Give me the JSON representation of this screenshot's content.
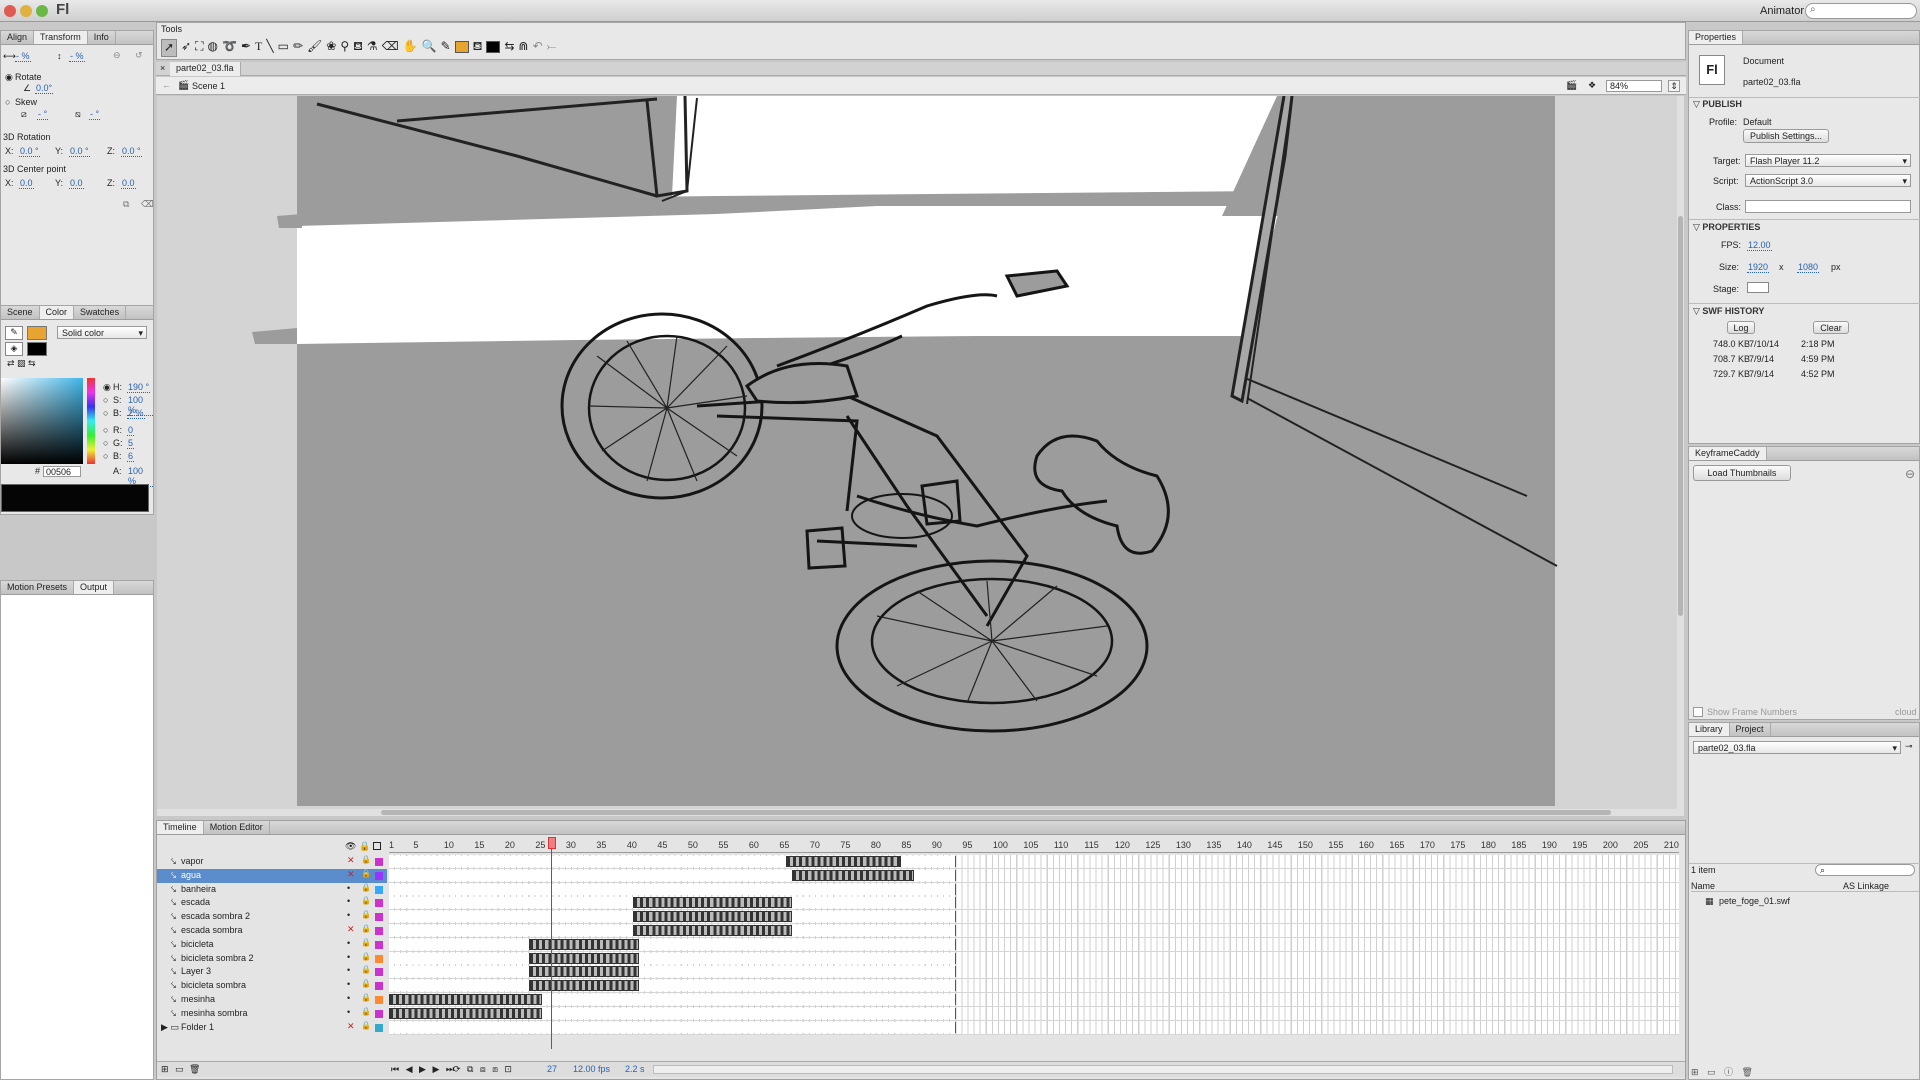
{
  "menubar": {
    "app_logo": "Fl",
    "workspace": "Animator ▾"
  },
  "tools_panel": {
    "label": "Tools"
  },
  "left_top_panel": {
    "tabs": [
      "Align",
      "Transform",
      "Info"
    ],
    "scale_w": "- %",
    "scale_h": "- %",
    "rotate_label": "Rotate",
    "rotate_value": "0.0°",
    "skew_label": "Skew",
    "skew_h": "- °",
    "skew_v": "- °",
    "rotation3d_label": "3D Rotation",
    "rot_x": "0.0 °",
    "rot_y": "0.0 °",
    "rot_z": "0.0 °",
    "center3d_label": "3D Center point",
    "cp_x": "0.0",
    "cp_y": "0.0",
    "cp_z": "0.0",
    "x_label": "X:",
    "y_label": "Y:",
    "z_label": "Z:"
  },
  "color_panel": {
    "tabs": [
      "Scene",
      "Color",
      "Swatches"
    ],
    "fill_type": "Solid color",
    "h_label": "H:",
    "h": "190 °",
    "s_label": "S:",
    "s": "100 %",
    "b_label": "B:",
    "b": "2 %",
    "r_label": "R:",
    "r": "0",
    "g_label": "G:",
    "g": "5",
    "bl_label": "B:",
    "bl": "6",
    "hex": "00506",
    "a_label": "A:",
    "alpha": "100 %"
  },
  "bottom_left_panel": {
    "tabs": [
      "Motion Presets",
      "Output"
    ]
  },
  "document": {
    "tab": "parte02_03.fla",
    "scene": "Scene 1",
    "zoom": "84%"
  },
  "properties": {
    "title": "Properties",
    "doc_type": "Document",
    "doc_name": "parte02_03.fla",
    "publish_header": "PUBLISH",
    "profile_label": "Profile:",
    "profile": "Default",
    "publish_settings": "Publish Settings...",
    "target_label": "Target:",
    "target": "Flash Player 11.2",
    "script_label": "Script:",
    "script": "ActionScript 3.0",
    "class_label": "Class:",
    "props_header": "PROPERTIES",
    "fps_label": "FPS:",
    "fps": "12.00",
    "size_label": "Size:",
    "width": "1920",
    "x_sep": "x",
    "height": "1080",
    "unit": "px",
    "stage_label": "Stage:",
    "swf_header": "SWF HISTORY",
    "log_btn": "Log",
    "clear_btn": "Clear",
    "history": [
      {
        "size": "748.0 KB",
        "date": "7/10/14",
        "time": "2:18 PM"
      },
      {
        "size": "708.7 KB",
        "date": "7/9/14",
        "time": "4:59 PM"
      },
      {
        "size": "729.7 KB",
        "date": "7/9/14",
        "time": "4:52 PM"
      }
    ]
  },
  "keyframe_caddy": {
    "title": "KeyframeCaddy",
    "load_btn": "Load Thumbnails",
    "show_numbers": "Show Frame Numbers",
    "brand": "cloud"
  },
  "library": {
    "tabs": [
      "Library",
      "Project"
    ],
    "file": "parte02_03.fla",
    "count": "1 item",
    "col_name": "Name",
    "col_linkage": "AS Linkage",
    "items": [
      "pete_foge_01.swf"
    ]
  },
  "timeline": {
    "tabs": [
      "Timeline",
      "Motion Editor"
    ],
    "ruler": [
      "1",
      "5",
      "10",
      "15",
      "20",
      "25",
      "30",
      "35",
      "40",
      "45",
      "50",
      "55",
      "60",
      "65",
      "70",
      "75",
      "80",
      "85",
      "90",
      "95",
      "100",
      "105",
      "110",
      "115",
      "120",
      "125",
      "130",
      "135",
      "140",
      "145",
      "150",
      "155",
      "160",
      "165",
      "170",
      "175",
      "180",
      "185",
      "190",
      "195",
      "200",
      "205",
      "210"
    ],
    "layers": [
      {
        "name": "vapor",
        "color": "#cc33cc",
        "hidden": true
      },
      {
        "name": "agua",
        "color": "#9933ff",
        "hidden": true,
        "selected": true
      },
      {
        "name": "banheira",
        "color": "#33aaff",
        "hidden": false
      },
      {
        "name": "escada",
        "color": "#cc33cc",
        "hidden": false
      },
      {
        "name": "escada sombra 2",
        "color": "#cc33cc",
        "hidden": false
      },
      {
        "name": "escada sombra",
        "color": "#cc33cc",
        "hidden": true
      },
      {
        "name": "bicicleta",
        "color": "#cc33cc",
        "hidden": false
      },
      {
        "name": "bicicleta sombra 2",
        "color": "#ff8833",
        "hidden": false
      },
      {
        "name": "Layer 3",
        "color": "#cc33cc",
        "hidden": false
      },
      {
        "name": "bicicleta sombra",
        "color": "#cc33cc",
        "hidden": false
      },
      {
        "name": "mesinha",
        "color": "#ff8833",
        "hidden": false
      },
      {
        "name": "mesinha sombra",
        "color": "#cc33cc",
        "hidden": false
      },
      {
        "name": "Folder 1",
        "color": "#33aacc",
        "hidden": true,
        "folder": true
      }
    ],
    "current_frame": "27",
    "fps": "12.00 fps",
    "elapsed": "2.2 s"
  }
}
